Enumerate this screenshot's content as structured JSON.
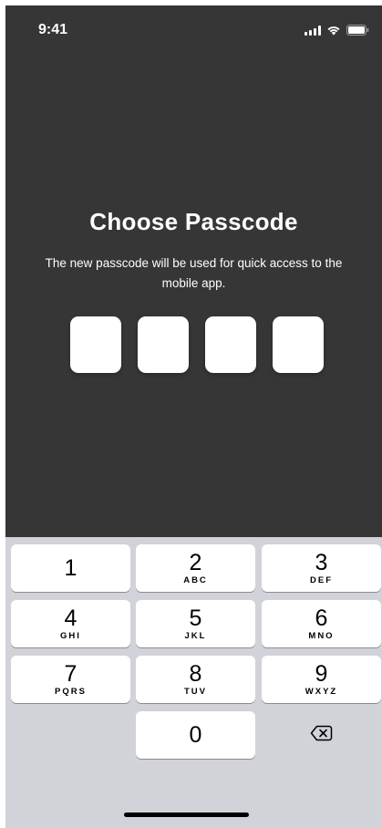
{
  "status_bar": {
    "time": "9:41"
  },
  "title": "Choose Passcode",
  "subtitle": "The new passcode will be used for quick access to the mobile app.",
  "passcode": {
    "length": 4,
    "filled": 0
  },
  "keypad": {
    "keys": [
      {
        "digit": "1",
        "letters": ""
      },
      {
        "digit": "2",
        "letters": "ABC"
      },
      {
        "digit": "3",
        "letters": "DEF"
      },
      {
        "digit": "4",
        "letters": "GHI"
      },
      {
        "digit": "5",
        "letters": "JKL"
      },
      {
        "digit": "6",
        "letters": "MNO"
      },
      {
        "digit": "7",
        "letters": "PQRS"
      },
      {
        "digit": "8",
        "letters": "TUV"
      },
      {
        "digit": "9",
        "letters": "WXYZ"
      },
      {
        "digit": "0",
        "letters": ""
      }
    ]
  },
  "colors": {
    "background": "#363636",
    "keypad_background": "#d1d3d9",
    "key": "#ffffff",
    "text": "#ffffff"
  },
  "icons": {
    "signal": "cellular-signal-icon",
    "wifi": "wifi-icon",
    "battery": "battery-icon",
    "delete": "backspace-icon"
  }
}
